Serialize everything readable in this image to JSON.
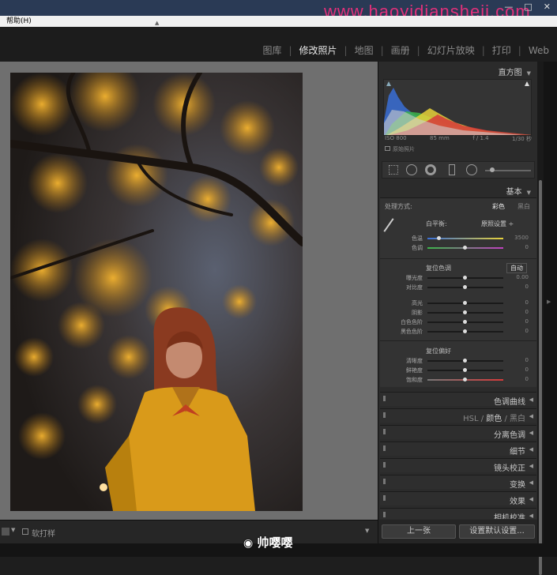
{
  "watermark": "www.haoyidiansheji.com",
  "menubar": {
    "help": "帮助(H)"
  },
  "modules": [
    "图库",
    "修改照片",
    "地图",
    "画册",
    "幻灯片放映",
    "打印",
    "Web"
  ],
  "active_module": "修改照片",
  "histogram": {
    "title": "直方图",
    "iso": "ISO 800",
    "focal": "85 mm",
    "aperture": "f / 1.4",
    "shutter": "1/30 秒",
    "original_photo": "原始照片"
  },
  "basic": {
    "title": "基本",
    "treatment_label": "处理方式:",
    "treatment_color": "彩色",
    "treatment_bw": "黑白",
    "wb_label": "白平衡:",
    "wb_value": "原照设置 ÷",
    "temp_label": "色温",
    "temp_value": "3500",
    "tint_label": "色调",
    "tint_value": "0",
    "tone_title": "色调",
    "tone_reset": "复位",
    "tone_auto": "自动",
    "exposure_label": "曝光度",
    "exposure_value": "0.00",
    "contrast_label": "对比度",
    "contrast_value": "0",
    "highlights_label": "高光",
    "highlights_value": "0",
    "shadows_label": "阴影",
    "shadows_value": "0",
    "whites_label": "白色色阶",
    "whites_value": "0",
    "blacks_label": "黑色色阶",
    "blacks_value": "0",
    "presence_title": "偏好",
    "presence_reset": "复位",
    "clarity_label": "清晰度",
    "clarity_value": "0",
    "vibrance_label": "鲜艳度",
    "vibrance_value": "0",
    "saturation_label": "饱和度",
    "saturation_value": "0"
  },
  "panels": {
    "tone_curve": "色调曲线",
    "hsl": "HSL",
    "hsl_color": "颜色",
    "hsl_bw": "黑白",
    "split_toning": "分离色调",
    "detail": "细节",
    "lens": "镜头校正",
    "transform": "变换",
    "effects": "效果",
    "calibration": "相机校准"
  },
  "buttons": {
    "previous": "上一张",
    "set_default": "设置默认设置..."
  },
  "filmstrip": {
    "soft_proof": "软打样"
  },
  "weibo_tag": "帅嘤嘤"
}
